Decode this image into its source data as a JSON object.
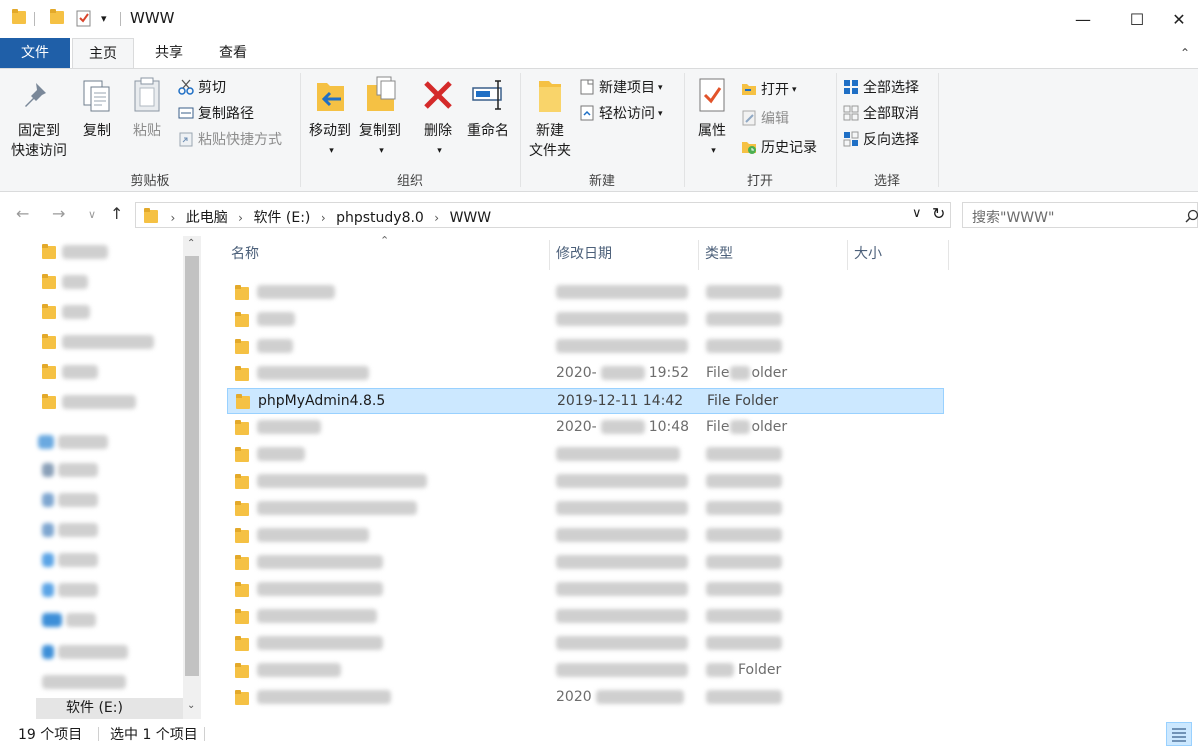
{
  "window": {
    "title": "WWW",
    "minimize": "—",
    "maximize": "☐",
    "close": "✕"
  },
  "tabs": {
    "file": "文件",
    "home": "主页",
    "share": "共享",
    "view": "查看",
    "collapse": "⌃"
  },
  "ribbon": {
    "clipboard": {
      "label": "剪贴板",
      "pin_line1": "固定到",
      "pin_line2": "快速访问",
      "copy": "复制",
      "paste": "粘贴",
      "cut": "剪切",
      "copy_path": "复制路径",
      "paste_shortcut": "粘贴快捷方式"
    },
    "organize": {
      "label": "组织",
      "move_to": "移动到",
      "copy_to": "复制到",
      "delete": "删除",
      "rename": "重命名"
    },
    "new": {
      "label": "新建",
      "new_folder_line1": "新建",
      "new_folder_line2": "文件夹",
      "new_item": "新建项目",
      "easy_access": "轻松访问"
    },
    "open": {
      "label": "打开",
      "properties": "属性",
      "open": "打开",
      "edit": "编辑",
      "history": "历史记录"
    },
    "select": {
      "label": "选择",
      "select_all": "全部选择",
      "select_none": "全部取消",
      "invert": "反向选择"
    }
  },
  "address": {
    "crumbs": [
      "此电脑",
      "软件 (E:)",
      "phpstudy8.0",
      "WWW"
    ],
    "search_placeholder": "搜索\"WWW\""
  },
  "nav": {
    "drive_label": "软件 (E:)"
  },
  "columns": {
    "name": "名称",
    "date": "修改日期",
    "type": "类型",
    "size": "大小"
  },
  "files": [
    {
      "name": "",
      "date": "",
      "type": ""
    },
    {
      "name": "",
      "date": "",
      "type": ""
    },
    {
      "name": "",
      "date": "",
      "type": ""
    },
    {
      "name": "",
      "date": "2020-",
      "type": "File",
      "date_tail": "19:52",
      "type_tail": "older"
    },
    {
      "name": "phpMyAdmin4.8.5",
      "date": "2019-12-11 14:42",
      "type": "File Folder",
      "selected": true
    },
    {
      "name": "",
      "date": "2020-",
      "type": "File",
      "date_tail": "10:48",
      "type_tail": "older"
    },
    {
      "name": "",
      "date": "",
      "type": ""
    },
    {
      "name": "",
      "date": "",
      "type": ""
    },
    {
      "name": "",
      "date": "",
      "type": ""
    },
    {
      "name": "",
      "date": "",
      "type": ""
    },
    {
      "name": "",
      "date": "",
      "type": ""
    },
    {
      "name": "",
      "date": "",
      "type": ""
    },
    {
      "name": "",
      "date": "",
      "type": ""
    },
    {
      "name": "",
      "date": "",
      "type": ""
    },
    {
      "name": "",
      "date": "",
      "type": "Folder"
    },
    {
      "name": "",
      "date": "2020",
      "type": ""
    }
  ],
  "status": {
    "item_count": "19 个项目",
    "selection": "选中 1 个项目"
  },
  "colors": {
    "file_tab": "#1f5fa8",
    "selection_bg": "#cce8ff",
    "selection_border": "#99d1ff",
    "folder": "#f5c144"
  }
}
